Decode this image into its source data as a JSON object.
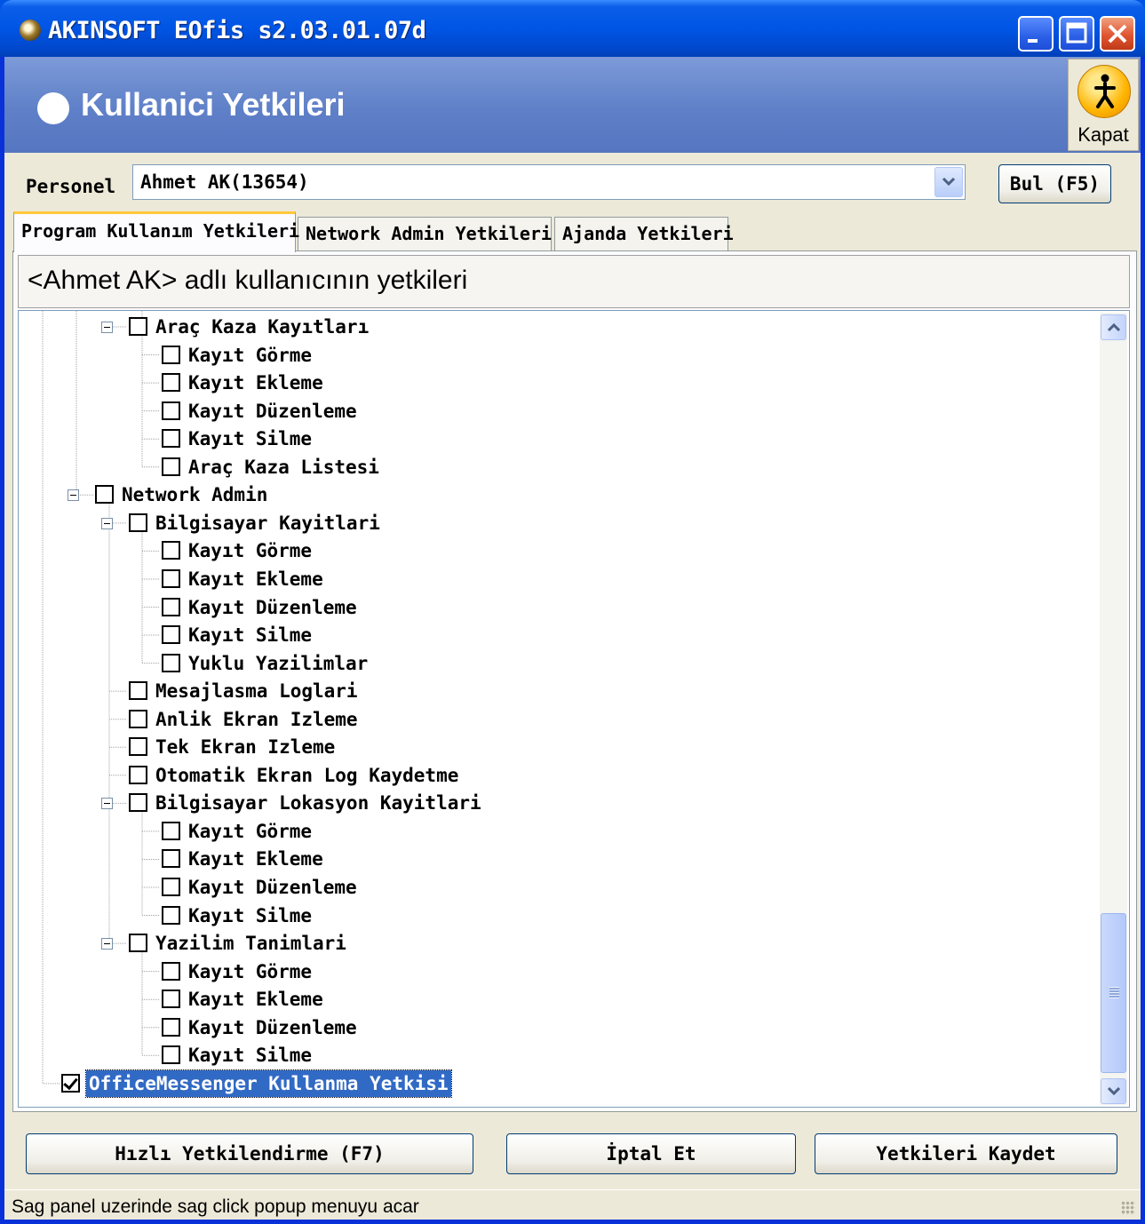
{
  "window": {
    "title": "AKINSOFT EOfis s2.03.01.07d",
    "controls": {
      "minimize": "_",
      "maximize": "□",
      "close": "✕"
    }
  },
  "banner": {
    "title": "Kullanici Yetkileri",
    "close_label": "Kapat"
  },
  "personel": {
    "label": "Personel",
    "value": "Ahmet AK(13654)",
    "find_button": "Bul (F5)"
  },
  "tabs": [
    {
      "label": "Program Kullanım Yetkileri",
      "active": true
    },
    {
      "label": "Network Admin Yetkileri",
      "active": false
    },
    {
      "label": "Ajanda Yetkileri",
      "active": false
    }
  ],
  "panel_heading": "<Ahmet AK> adlı kullanıcının yetkileri",
  "tree": [
    {
      "label": "Araç Kaza Kayıtları",
      "level": 2,
      "expander": true,
      "checked": false
    },
    {
      "label": "Kayıt Görme",
      "level": 3,
      "checked": false
    },
    {
      "label": "Kayıt Ekleme",
      "level": 3,
      "checked": false
    },
    {
      "label": "Kayıt Düzenleme",
      "level": 3,
      "checked": false
    },
    {
      "label": "Kayıt Silme",
      "level": 3,
      "checked": false
    },
    {
      "label": "Araç Kaza Listesi",
      "level": 3,
      "checked": false
    },
    {
      "label": "Network Admin",
      "level": 1,
      "expander": true,
      "checked": false
    },
    {
      "label": "Bilgisayar Kayitlari",
      "level": 2,
      "expander": true,
      "checked": false
    },
    {
      "label": "Kayıt Görme",
      "level": 3,
      "checked": false
    },
    {
      "label": "Kayıt Ekleme",
      "level": 3,
      "checked": false
    },
    {
      "label": "Kayıt Düzenleme",
      "level": 3,
      "checked": false
    },
    {
      "label": "Kayıt Silme",
      "level": 3,
      "checked": false
    },
    {
      "label": "Yuklu Yazilimlar",
      "level": 3,
      "checked": false
    },
    {
      "label": "Mesajlasma Loglari",
      "level": 2,
      "checked": false
    },
    {
      "label": "Anlik Ekran Izleme",
      "level": 2,
      "checked": false
    },
    {
      "label": "Tek Ekran Izleme",
      "level": 2,
      "checked": false
    },
    {
      "label": "Otomatik Ekran Log Kaydetme",
      "level": 2,
      "checked": false
    },
    {
      "label": "Bilgisayar Lokasyon Kayitlari",
      "level": 2,
      "expander": true,
      "checked": false
    },
    {
      "label": "Kayıt Görme",
      "level": 3,
      "checked": false
    },
    {
      "label": "Kayıt Ekleme",
      "level": 3,
      "checked": false
    },
    {
      "label": "Kayıt Düzenleme",
      "level": 3,
      "checked": false
    },
    {
      "label": "Kayıt Silme",
      "level": 3,
      "checked": false
    },
    {
      "label": "Yazilim Tanimlari",
      "level": 2,
      "expander": true,
      "checked": false
    },
    {
      "label": "Kayıt Görme",
      "level": 3,
      "checked": false
    },
    {
      "label": "Kayıt Ekleme",
      "level": 3,
      "checked": false
    },
    {
      "label": "Kayıt Düzenleme",
      "level": 3,
      "checked": false
    },
    {
      "label": "Kayıt Silme",
      "level": 3,
      "checked": false
    },
    {
      "label": "OfficeMessenger Kullanma Yetkisi",
      "level": 0,
      "checked": true,
      "selected": true
    }
  ],
  "buttons": {
    "quick": "Hızlı Yetkilendirme (F7)",
    "cancel": "İptal Et",
    "save": "Yetkileri Kaydet"
  },
  "status": "Sag panel uzerinde sag click popup menuyu acar",
  "colors": {
    "titlebar": "#0055e5",
    "banner": "#5f80c8",
    "selection": "#316ac5",
    "face": "#ece9d8"
  }
}
